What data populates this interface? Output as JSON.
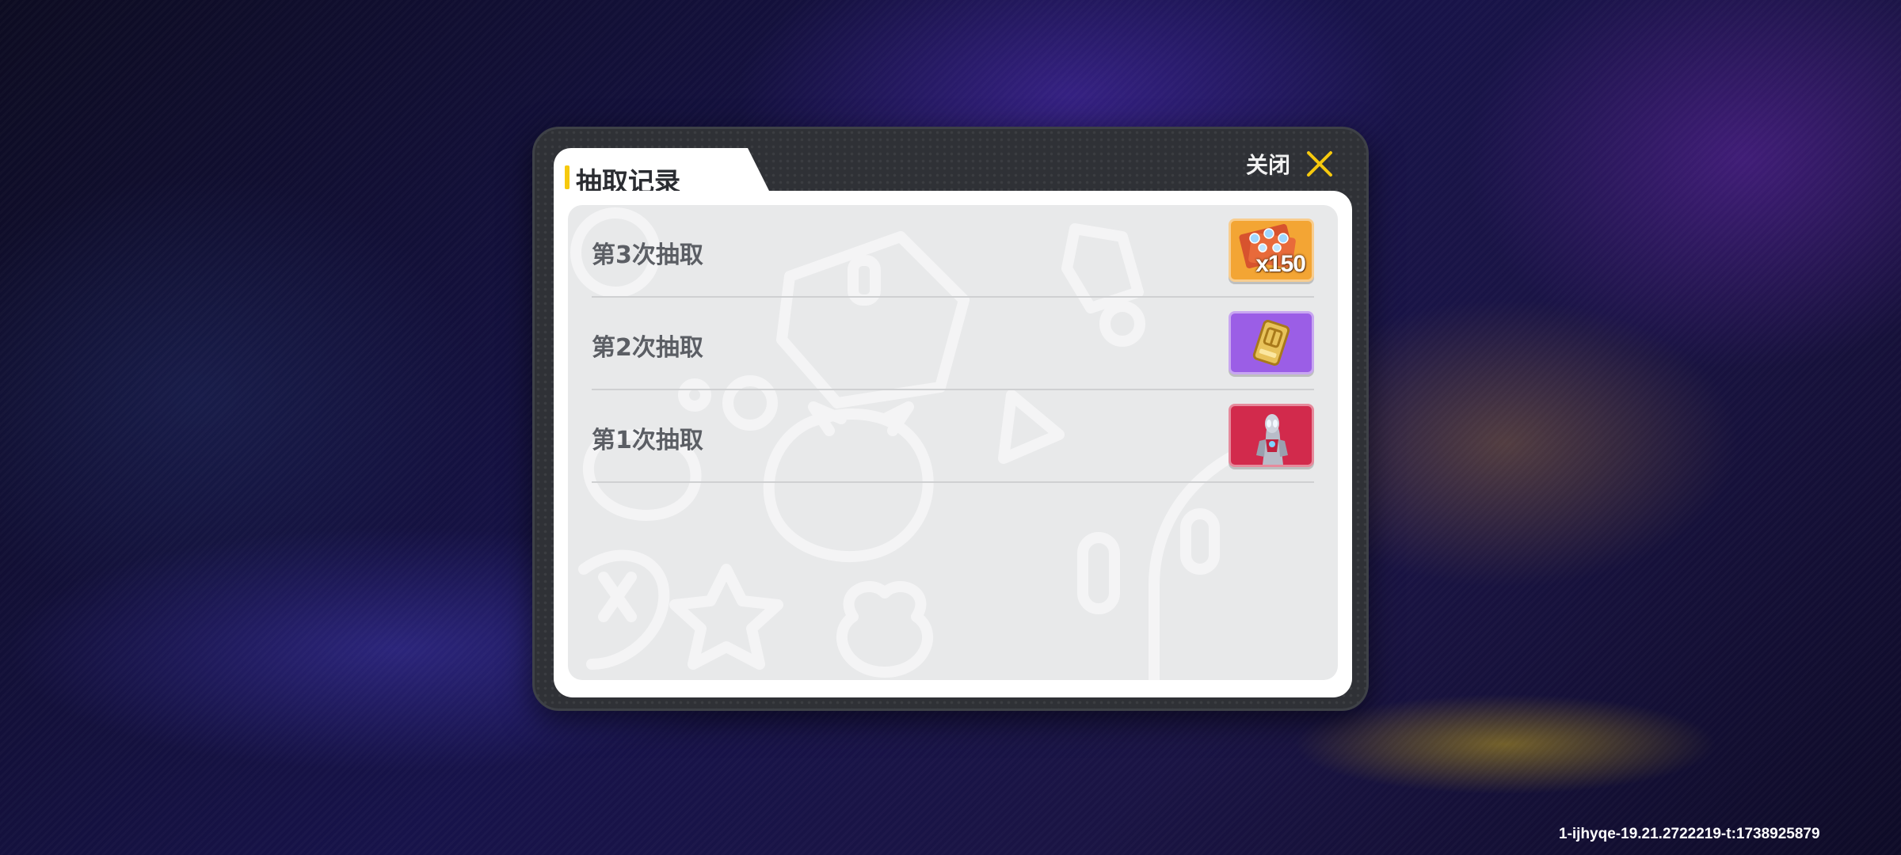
{
  "dialog": {
    "title": "抽取记录",
    "close_label": "关闭",
    "accent_color": "#f6c90e"
  },
  "records": [
    {
      "label": "第3次抽取",
      "reward_icon": "gem-bundle-icon",
      "reward_count": "x150",
      "frame_color": "#f3a534"
    },
    {
      "label": "第2次抽取",
      "reward_icon": "gold-ticket-icon",
      "reward_count": "",
      "frame_color": "#9b5ee6"
    },
    {
      "label": "第1次抽取",
      "reward_icon": "ultraman-figure-icon",
      "reward_count": "",
      "frame_color": "#d22a4c"
    }
  ],
  "footer": {
    "version": "1-ijhyqe-19.21.2722219-t:1738925879"
  }
}
